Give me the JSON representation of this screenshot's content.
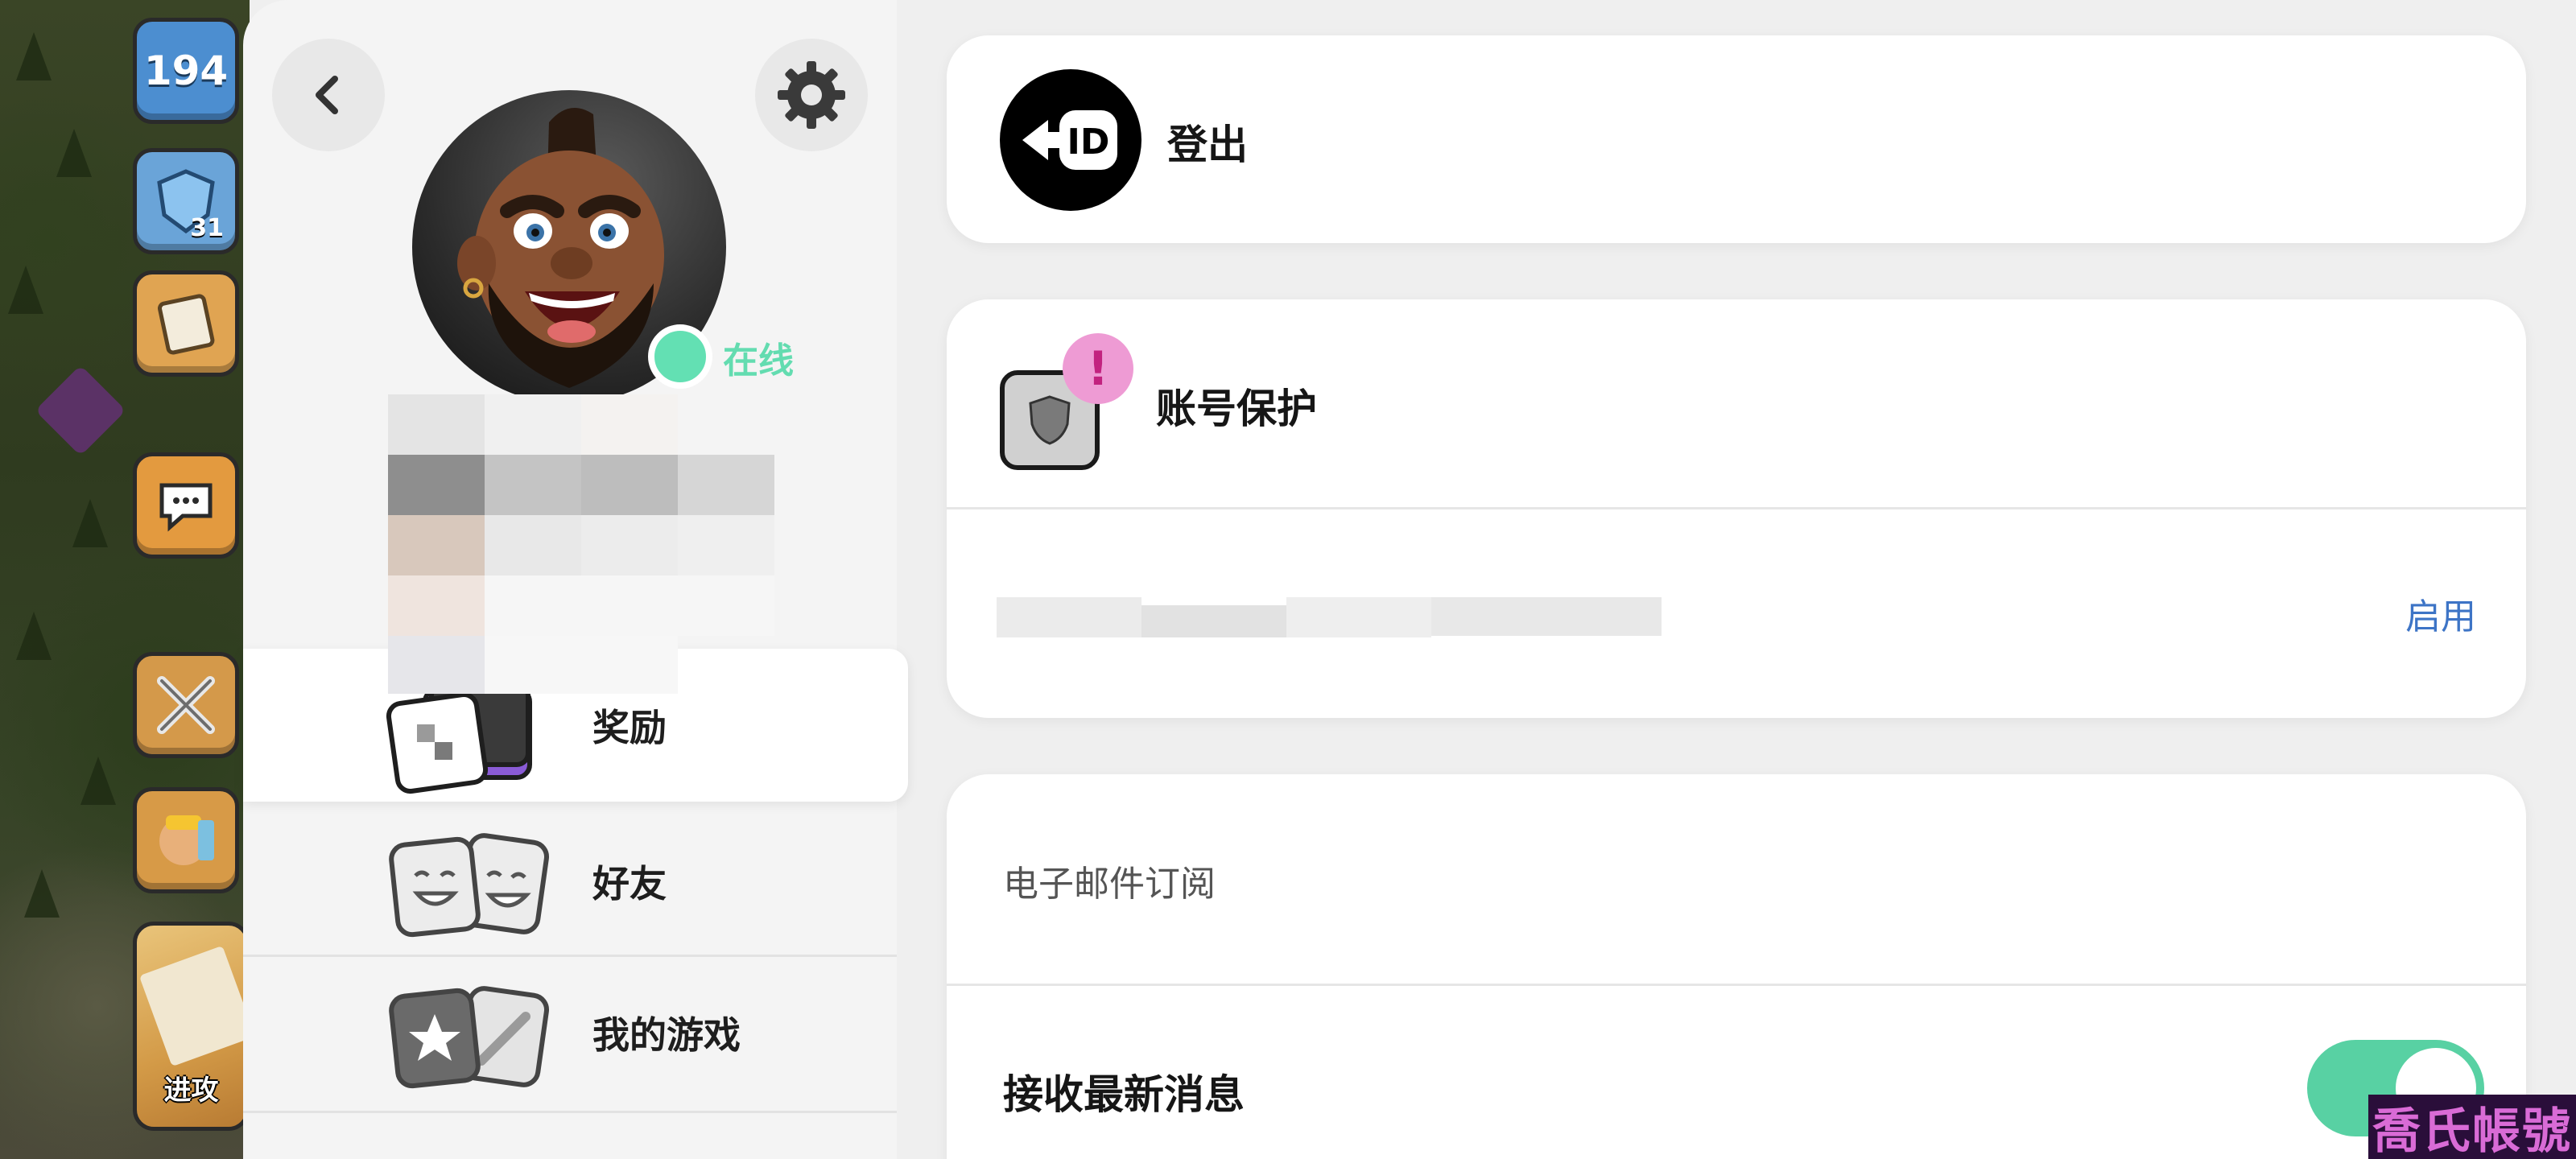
{
  "game": {
    "trophy_count": "194",
    "league_level": "31",
    "attack_label": "进攻"
  },
  "profile": {
    "status_label": "在线",
    "menu": [
      {
        "label": "奖励",
        "active": true
      },
      {
        "label": "好友",
        "active": false
      },
      {
        "label": "我的游戏",
        "active": false
      }
    ]
  },
  "settings": {
    "logout": {
      "label": "登出",
      "icon_text": "ID"
    },
    "account_protection": {
      "title": "账号保护",
      "action_label": "启用"
    },
    "email": {
      "section_label": "电子邮件订阅",
      "receive_label": "接收最新消息",
      "receive_enabled": true
    }
  },
  "watermark": "喬氏帳號",
  "colors": {
    "online_green": "#63e0b3",
    "toggle_green": "#58d1a3",
    "link_blue": "#3d74c6",
    "alert_pink": "#ee9bd4"
  }
}
